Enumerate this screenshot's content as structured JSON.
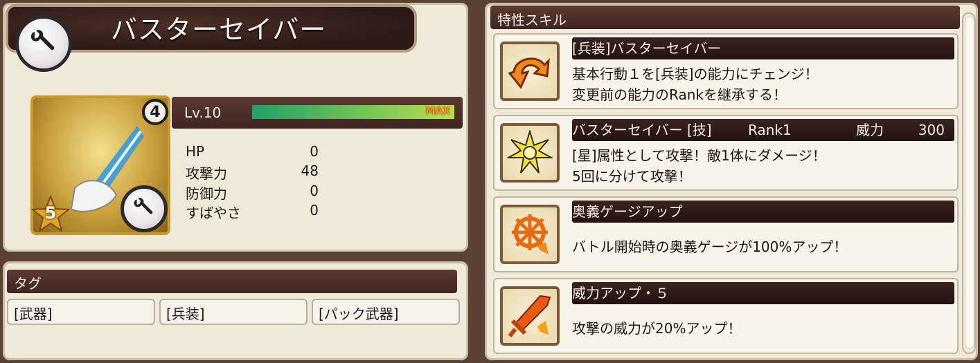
{
  "weapon": {
    "name": "バスターセイバー",
    "level_label": "Lv.10",
    "max_label": "MAX",
    "rank_badge": "4",
    "star_count": "5",
    "level_progress": 1.0,
    "stats": [
      {
        "label": "HP",
        "value": "0"
      },
      {
        "label": "攻撃力",
        "value": "48"
      },
      {
        "label": "防御力",
        "value": "0"
      },
      {
        "label": "すばやさ",
        "value": "0"
      }
    ]
  },
  "tags": {
    "header": "タグ",
    "items": [
      "[武器]",
      "[兵装]",
      "[パック武器]"
    ]
  },
  "skills": {
    "header": "特性スキル",
    "items": [
      {
        "icon": "change-arrow-icon",
        "title": "[兵装]バスターセイバー",
        "desc1": "基本行動１を[兵装]の能力にチェンジ！",
        "desc2": "変更前の能力のRankを継承する！"
      },
      {
        "icon": "star-burst-icon",
        "title": "バスターセイバー [技]",
        "rank": "Rank1",
        "power_label": "威力",
        "power_value": "300",
        "desc1": "[星]属性として攻撃！敵1体にダメージ！",
        "desc2": "5回に分けて攻撃！"
      },
      {
        "icon": "ougi-gauge-icon",
        "title": "奥義ゲージアップ",
        "desc1": "バトル開始時の奥義ゲージが100%アップ！"
      },
      {
        "icon": "sword-up-icon",
        "title": "威力アップ・５",
        "desc1": "攻撃の威力が20%アップ！"
      }
    ]
  },
  "colors": {
    "frame": "#5a3f33",
    "panel": "#eee9d8",
    "header": "#4a2d28",
    "gauge_start": "#1fa06a",
    "gauge_end": "#b8e04a"
  }
}
